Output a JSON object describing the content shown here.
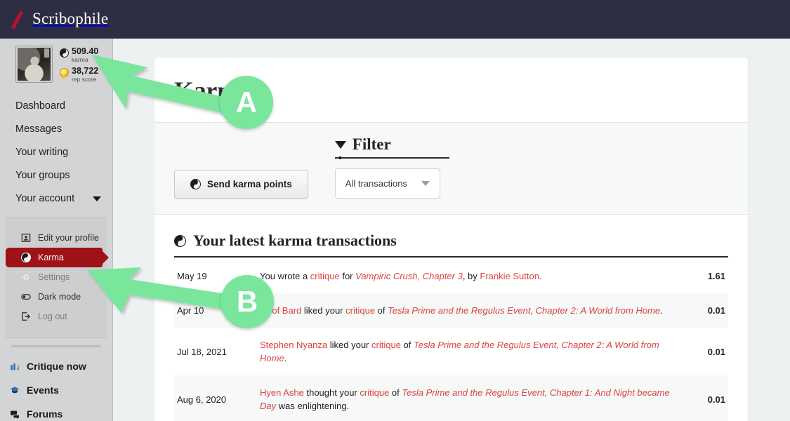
{
  "header": {
    "brand": "Scribophile",
    "logo_icon": "red-slash-logo"
  },
  "sidebar": {
    "profile": {
      "karma_value": "509.40",
      "karma_label": "karma",
      "rep_value": "38,722",
      "rep_label": "rep score",
      "karma_icon": "yinyang-icon",
      "rep_icon": "medal-icon",
      "avatar_alt": "user-avatar"
    },
    "main_nav": [
      {
        "label": "Dashboard"
      },
      {
        "label": "Messages"
      },
      {
        "label": "Your writing"
      },
      {
        "label": "Your groups"
      },
      {
        "label": "Your account",
        "has_chevron": true
      }
    ],
    "account_submenu": [
      {
        "label": "Edit your profile",
        "icon": "profile-card-icon",
        "active": false,
        "muted": false
      },
      {
        "label": "Karma",
        "icon": "yinyang-icon",
        "active": true,
        "muted": false
      },
      {
        "label": "Settings",
        "icon": "gear-icon",
        "active": false,
        "muted": true
      },
      {
        "label": "Dark mode",
        "icon": "toggle-icon",
        "active": false,
        "muted": false
      },
      {
        "label": "Log out",
        "icon": "logout-icon",
        "active": false,
        "muted": true
      }
    ],
    "bottom_nav": [
      {
        "label": "Critique now",
        "icon": "bar-chart-icon"
      },
      {
        "label": "Events",
        "icon": "graduation-cap-icon"
      },
      {
        "label": "Forums",
        "icon": "speech-bubbles-icon"
      }
    ]
  },
  "main": {
    "page_title": "Karma",
    "toolbar": {
      "send_karma_label": "Send karma points",
      "send_karma_icon": "yinyang-icon",
      "filter_label": "Filter",
      "filter_icon": "funnel-icon",
      "filter_select_value": "All transactions",
      "filter_select_chevron": "chevron-down-icon"
    },
    "transactions": {
      "heading": "Your latest karma transactions",
      "heading_icon": "yinyang-icon",
      "rows": [
        {
          "date": "May 19",
          "amount": "1.61",
          "striped": false,
          "parts": [
            {
              "text": "You wrote a ",
              "style": "plain"
            },
            {
              "text": "critique",
              "style": "link"
            },
            {
              "text": " for ",
              "style": "plain"
            },
            {
              "text": "Vampiric Crush, Chapter 3",
              "style": "link-italic"
            },
            {
              "text": ", by ",
              "style": "plain"
            },
            {
              "text": "Frankie Sutton",
              "style": "link"
            },
            {
              "text": ".",
              "style": "plain"
            }
          ]
        },
        {
          "date": "Apr 10",
          "amount": "0.01",
          "striped": true,
          "parts": [
            {
              "text": "Geof Bard",
              "style": "link"
            },
            {
              "text": " liked your ",
              "style": "plain"
            },
            {
              "text": "critique",
              "style": "link"
            },
            {
              "text": " of ",
              "style": "plain"
            },
            {
              "text": "Tesla Prime and the Regulus Event, Chapter 2: A World from Home",
              "style": "link-italic"
            },
            {
              "text": ".",
              "style": "plain"
            }
          ]
        },
        {
          "date": "Jul 18, 2021",
          "amount": "0.01",
          "striped": false,
          "parts": [
            {
              "text": "Stephen Nyanza",
              "style": "link"
            },
            {
              "text": " liked your ",
              "style": "plain"
            },
            {
              "text": "critique",
              "style": "link"
            },
            {
              "text": " of ",
              "style": "plain"
            },
            {
              "text": "Tesla Prime and the Regulus Event, Chapter 2: A World from Home",
              "style": "link-italic"
            },
            {
              "text": ".",
              "style": "plain"
            }
          ]
        },
        {
          "date": "Aug 6, 2020",
          "amount": "0.01",
          "striped": true,
          "parts": [
            {
              "text": "Hyen Ashe",
              "style": "link"
            },
            {
              "text": " thought your ",
              "style": "plain"
            },
            {
              "text": "critique",
              "style": "link"
            },
            {
              "text": " of ",
              "style": "plain"
            },
            {
              "text": "Tesla Prime and the Regulus Event, Chapter 1: And Night became Day",
              "style": "link-italic"
            },
            {
              "text": " was enlightening.",
              "style": "plain"
            }
          ]
        }
      ]
    }
  },
  "annotations": [
    {
      "id": "A",
      "label": "A"
    },
    {
      "id": "B",
      "label": "B"
    }
  ],
  "colors": {
    "header_bg": "#2c2c41",
    "brand_red": "#b8112a",
    "sidebar_bg": "#d2d4d6",
    "active_red": "#9e1218",
    "link_red": "#d9453d",
    "karma_green": "#5cb85c",
    "annotation_green": "#79e69b",
    "page_bg": "#eef1f2"
  }
}
